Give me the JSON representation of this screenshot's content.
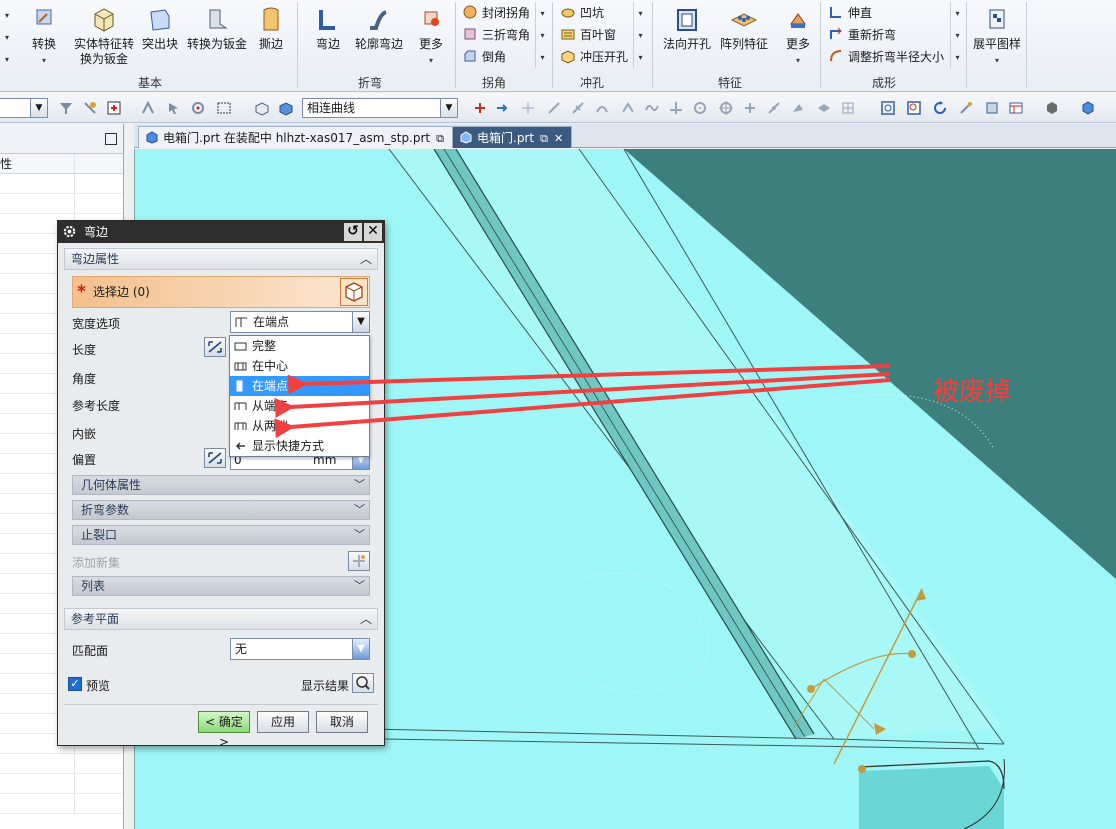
{
  "ribbon": {
    "groups": {
      "basic": "基本",
      "bend": "折弯",
      "corner": "拐角",
      "punch": "冲孔",
      "feature": "特征",
      "forming": "成形"
    },
    "buttons": {
      "convert": "转换",
      "solid_feature_convert": "实体特征转\n换为钣金",
      "tab": "突出块",
      "convert_to_sheetmetal": "转换为钣金",
      "rip": "撕边",
      "flange": "弯边",
      "contour_flange": "轮廓弯边",
      "more1": "更多",
      "closed_corner": "封闭拐角",
      "three_bend_corner": "三折弯角",
      "chamfer": "倒角",
      "dimple": "凹坑",
      "louver": "百叶窗",
      "drawn_cutout": "冲压开孔",
      "normal_cutout": "法向开孔",
      "pattern_feature": "阵列特征",
      "more2": "更多",
      "unbend": "伸直",
      "rebend": "重新折弯",
      "resize_bend_radius": "调整折弯半径大小",
      "flat_pattern": "展平图样"
    }
  },
  "toolbar": {
    "curve_rule": "相连曲线"
  },
  "tabs": [
    {
      "label": "电箱门.prt 在装配中 hlhzt-xas017_asm_stp.prt"
    },
    {
      "label": "电箱门.prt"
    }
  ],
  "navpanel": {
    "col_header": "性"
  },
  "dialog": {
    "title": "弯边",
    "sections": {
      "flange_props": "弯边属性",
      "ref_plane": "参考平面"
    },
    "select_edge": "选择边 (0)",
    "labels": {
      "width_option": "宽度选项",
      "length": "长度",
      "angle": "角度",
      "ref_length": "参考长度",
      "inset": "内嵌",
      "offset": "偏置",
      "add_new_set": "添加新集",
      "match_face": "匹配面",
      "preview": "预览",
      "show_result": "显示结果"
    },
    "width_value": "在端点",
    "offset_value": "0",
    "offset_unit": "mm",
    "match_face_value": "无",
    "subsections": {
      "body_props": "几何体属性",
      "bend_params": "折弯参数",
      "relief": "止裂口",
      "list": "列表"
    },
    "buttons": {
      "ok": "< 确定 >",
      "apply": "应用",
      "cancel": "取消"
    },
    "dropdown": [
      "完整",
      "在中心",
      "在端点",
      "从端点",
      "从两端",
      "显示快捷方式"
    ],
    "dropdown_selected_index": 2
  },
  "annotation": {
    "text": "被废掉",
    "color": "#ff3c3c"
  }
}
